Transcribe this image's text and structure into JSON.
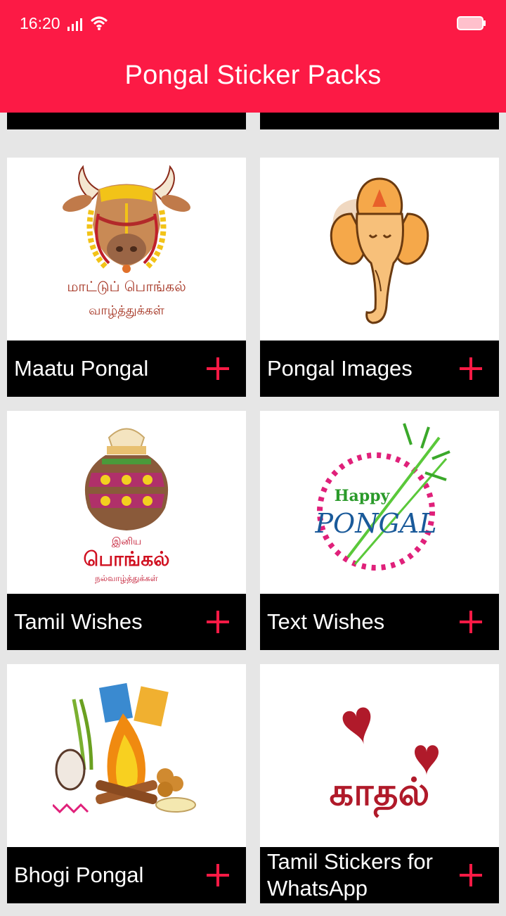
{
  "status": {
    "time": "16:20"
  },
  "appbar": {
    "title": "Pongal Sticker Packs"
  },
  "colors": {
    "appbar": "#fc1a45",
    "accent": "#fc1a45",
    "bar": "#000000",
    "background": "#e6e6e6"
  },
  "packs": [
    {
      "label": "Maatu Pongal",
      "image_icon": "decorated-bull-icon",
      "tamil_text": [
        "மாட்டுப் பொங்கல்",
        "வாழ்த்துக்கள்"
      ]
    },
    {
      "label": "Pongal Images",
      "image_icon": "ganesha-icon"
    },
    {
      "label": "Tamil Wishes",
      "image_icon": "pongal-pot-icon",
      "tamil_text": [
        "இனிய",
        "பொங்கல்",
        "நல்வாழ்த்துக்கள்"
      ]
    },
    {
      "label": "Text Wishes",
      "image_icon": "happy-pongal-text-icon",
      "art_text": [
        "Happy",
        "PONGAL"
      ]
    },
    {
      "label": "Bhogi Pongal",
      "image_icon": "bonfire-icon"
    },
    {
      "label": "Tamil Stickers for WhatsApp",
      "image_icon": "kadhal-hearts-icon",
      "tamil_text": [
        "காதல்"
      ]
    }
  ],
  "add_icon": "plus-icon"
}
